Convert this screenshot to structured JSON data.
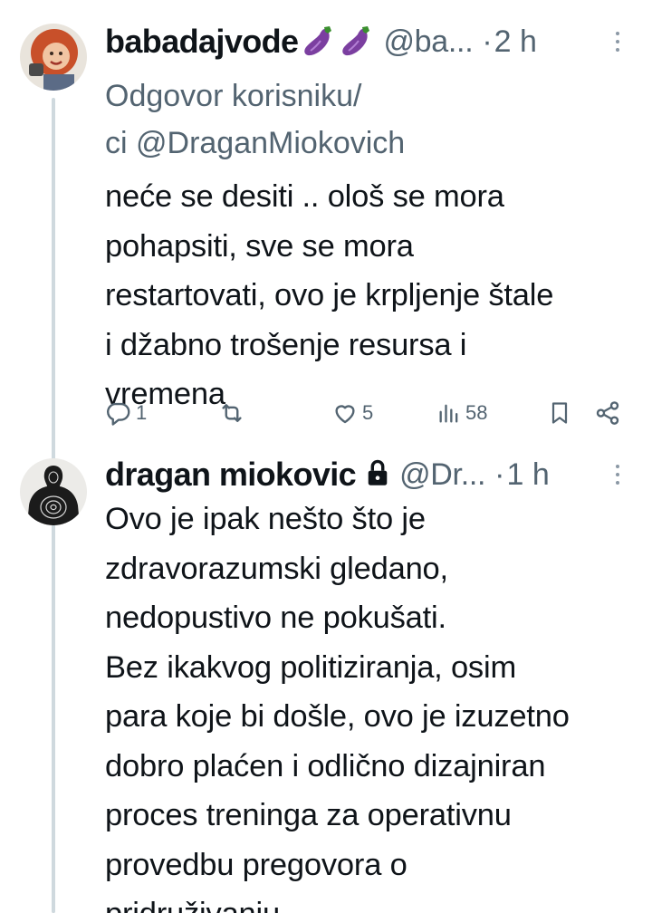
{
  "tweet1": {
    "display_name": "babadajvode",
    "name_emojis": [
      "eggplant-icon",
      "eggplant-icon"
    ],
    "handle": "@ba...",
    "separator": "·",
    "time": "2 h",
    "reply_prefix": "Odgovor korisniku/",
    "reply_line2_prefix": "ci ",
    "reply_handle": "@DraganMiokovich",
    "text": "neće se desiti .. ološ se mora\npohapsiti, sve se mora\nrestartovati, ovo je krpljenje štale\ni džabno trošenje resursa i\nvremena",
    "stats": {
      "replies": "1",
      "reposts": "",
      "likes": "5",
      "views": "58"
    }
  },
  "tweet2": {
    "display_name": "dragan miokovic",
    "protected_icon": "lock-icon",
    "handle": "@Dr...",
    "separator": "·",
    "time": "1 h",
    "text": "Ovo je ipak nešto što je\nzdravorazumski gledano,\nnedopustivo ne pokušati.\nBez ikakvog politiziranja, osim\npara koje bi došle, ovo je izuzetno\ndobro plaćen i odlično dizajniran\nproces  treninga za operativnu\nprovedbu pregovora o\npridruživanju."
  },
  "colors": {
    "text": "#0f1419",
    "secondary": "#536471",
    "thread_line": "#cfd9de",
    "eggplant": "#7b3fa0"
  }
}
